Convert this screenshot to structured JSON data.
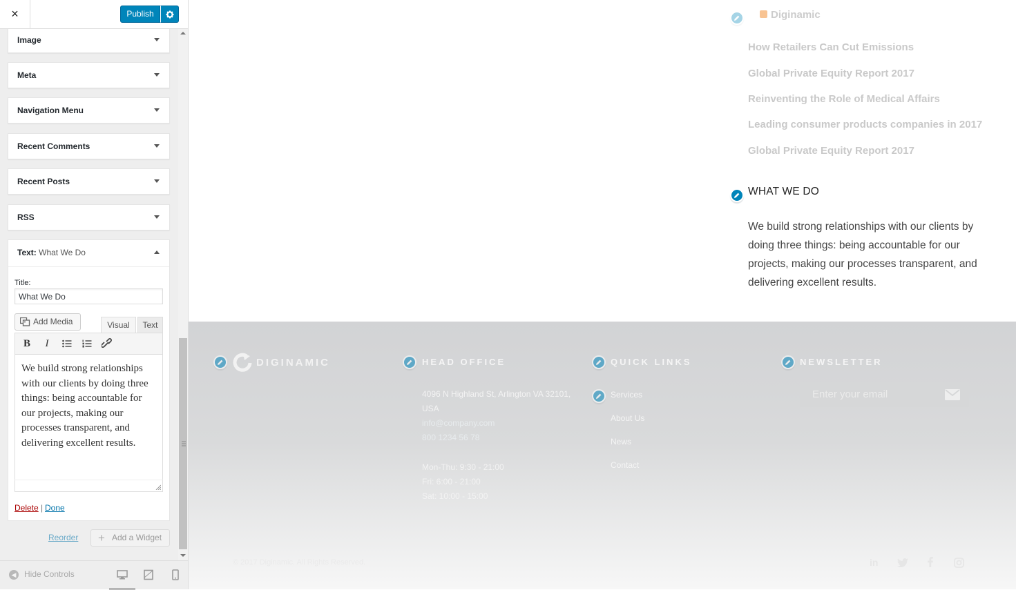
{
  "sidebar": {
    "close_icon": "×",
    "publish_label": "Publish",
    "widgets": [
      {
        "label": "Image"
      },
      {
        "label": "Meta"
      },
      {
        "label": "Navigation Menu"
      },
      {
        "label": "Recent Comments"
      },
      {
        "label": "Recent Posts"
      },
      {
        "label": "RSS"
      }
    ],
    "text_widget": {
      "header_prefix": "Text:",
      "header_name": "What We Do",
      "title_label": "Title:",
      "title_value": "What We Do",
      "add_media_label": "Add Media",
      "tab_visual": "Visual",
      "tab_text": "Text",
      "content": "We build strong relationships with our clients by doing three things: being accountable for our projects, making our processes transparent, and delivering excellent results.",
      "delete_label": "Delete",
      "separator": "|",
      "done_label": "Done"
    },
    "reorder_label": "Reorder",
    "add_widget_label": "Add a Widget",
    "hide_controls_label": "Hide Controls"
  },
  "preview": {
    "rss_title": "Diginamic",
    "rss_items": [
      "How Retailers Can Cut Emissions",
      "Global Private Equity Report 2017",
      "Reinventing the Role of Medical Affairs",
      "Leading consumer products companies in 2017",
      "Global Private Equity Report 2017"
    ],
    "what_we_do_title": "WHAT WE DO",
    "what_we_do_body": "We build strong relationships with our clients by doing three things: being accountable for our projects, making our processes transparent, and delivering excellent results.",
    "footer": {
      "logo_text": "DIGINAMIC",
      "head_office_title": "HEAD OFFICE",
      "address_line1": "4096 N Highland St, Arlington VA 32101,",
      "address_line2": "USA",
      "email": "info@company.com",
      "phone": "800 1234 56 78",
      "hours_1": "Mon-Thu: 9:30 - 21:00",
      "hours_2": "Fri: 6:00 - 21:00",
      "hours_3": "Sat: 10:00 - 15:00",
      "quick_links_title": "QUICK LINKS",
      "quick_links": [
        "Services",
        "About Us",
        "News",
        "Contact"
      ],
      "newsletter_title": "NEWSLETTER",
      "newsletter_placeholder": "Enter your email",
      "copyright": "© 2017 Diginamic. All Rights Reserved.",
      "social": [
        "linkedin-icon",
        "twitter-icon",
        "facebook-icon",
        "instagram-icon"
      ]
    }
  },
  "colors": {
    "accent": "#0085ba",
    "delete": "#aa0000",
    "link": "#0073aa"
  }
}
